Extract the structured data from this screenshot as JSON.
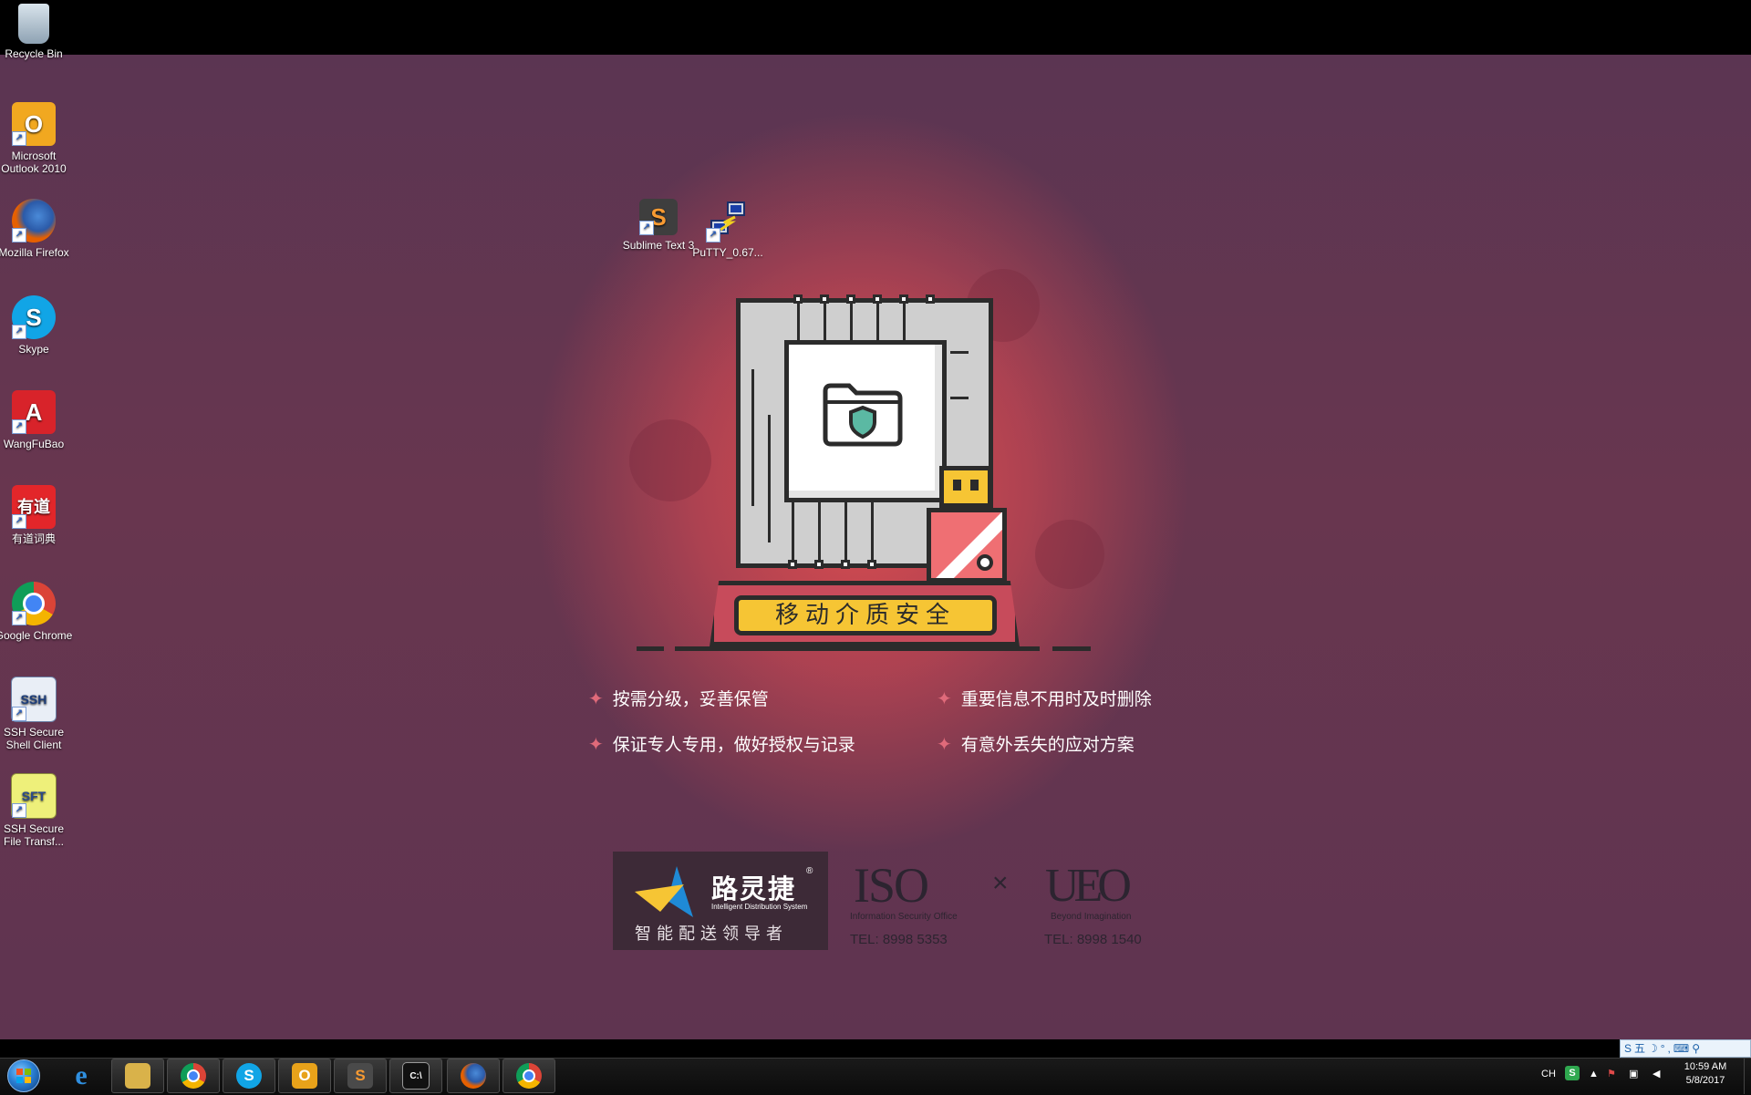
{
  "desktop": {
    "left_icons": [
      {
        "label": "Recycle Bin",
        "icon": "recycle-bin-icon"
      },
      {
        "label": "Microsoft Outlook 2010",
        "icon": "outlook-icon"
      },
      {
        "label": "Mozilla Firefox",
        "icon": "firefox-icon"
      },
      {
        "label": "Skype",
        "icon": "skype-icon"
      },
      {
        "label": "WangFuBao",
        "icon": "wangfubao-icon"
      },
      {
        "label": "有道词典",
        "icon": "youdao-icon"
      },
      {
        "label": "Google Chrome",
        "icon": "chrome-icon"
      },
      {
        "label": "SSH Secure Shell Client",
        "icon": "ssh-client-icon"
      },
      {
        "label": "SSH Secure File Transf...",
        "icon": "ssh-file-transfer-icon"
      }
    ],
    "center_icons": [
      {
        "label": "Sublime Text 3",
        "icon": "sublime-text-icon"
      },
      {
        "label": "PuTTY_0.67...",
        "icon": "putty-icon"
      }
    ]
  },
  "wallpaper": {
    "banner": "移动介质安全",
    "bullets": [
      "按需分级，妥善保管",
      "重要信息不用时及时删除",
      "保证专人专用，做好授权与记录",
      "有意外丢失的应对方案"
    ],
    "logo": {
      "name": "路灵捷",
      "reg": "®",
      "english": "Intelligent Distribution System",
      "slogan": "智能配送领导者"
    },
    "iso": {
      "word": "ISO",
      "subtitle": "Information Security Office",
      "tel": "TEL: 8998 5353"
    },
    "separator": "×",
    "ueo": {
      "word": "UEO",
      "subtitle": "Beyond Imagination",
      "tel": "TEL: 8998 1540"
    }
  },
  "taskbar": {
    "pinned": [
      {
        "name": "internet-explorer",
        "icon": "ie-icon",
        "glyph": "e",
        "color": "#2f8fe0"
      },
      {
        "name": "file-explorer",
        "icon": "folder-icon",
        "glyph": "▭",
        "color": "#d9b24a"
      },
      {
        "name": "chrome",
        "icon": "chrome-icon",
        "glyph": "◉",
        "color": "#dd4b39"
      },
      {
        "name": "skype",
        "icon": "skype-icon",
        "glyph": "S",
        "color": "#11a5e6"
      },
      {
        "name": "outlook",
        "icon": "outlook-icon",
        "glyph": "O",
        "color": "#e8a21a"
      },
      {
        "name": "sublime-text",
        "icon": "sublime-text-icon",
        "glyph": "S",
        "color": "#4a4a4a"
      },
      {
        "name": "command-prompt",
        "icon": "cmd-icon",
        "glyph": "C:\\",
        "color": "#111111"
      },
      {
        "name": "firefox",
        "icon": "firefox-icon",
        "glyph": "◉",
        "color": "#e66000"
      },
      {
        "name": "chrome-2",
        "icon": "chrome-icon",
        "glyph": "◉",
        "color": "#dd4b39"
      }
    ],
    "tray": {
      "language": "CH",
      "ime_bar": "S五☽°,⌨⚲",
      "time": "10:59 AM",
      "date": "5/8/2017"
    }
  },
  "colors": {
    "wallpaper_base": "#5f3450",
    "wallpaper_glow": "#e64e4e",
    "accent_yellow": "#f6c534",
    "accent_pink": "#ef6f73"
  }
}
